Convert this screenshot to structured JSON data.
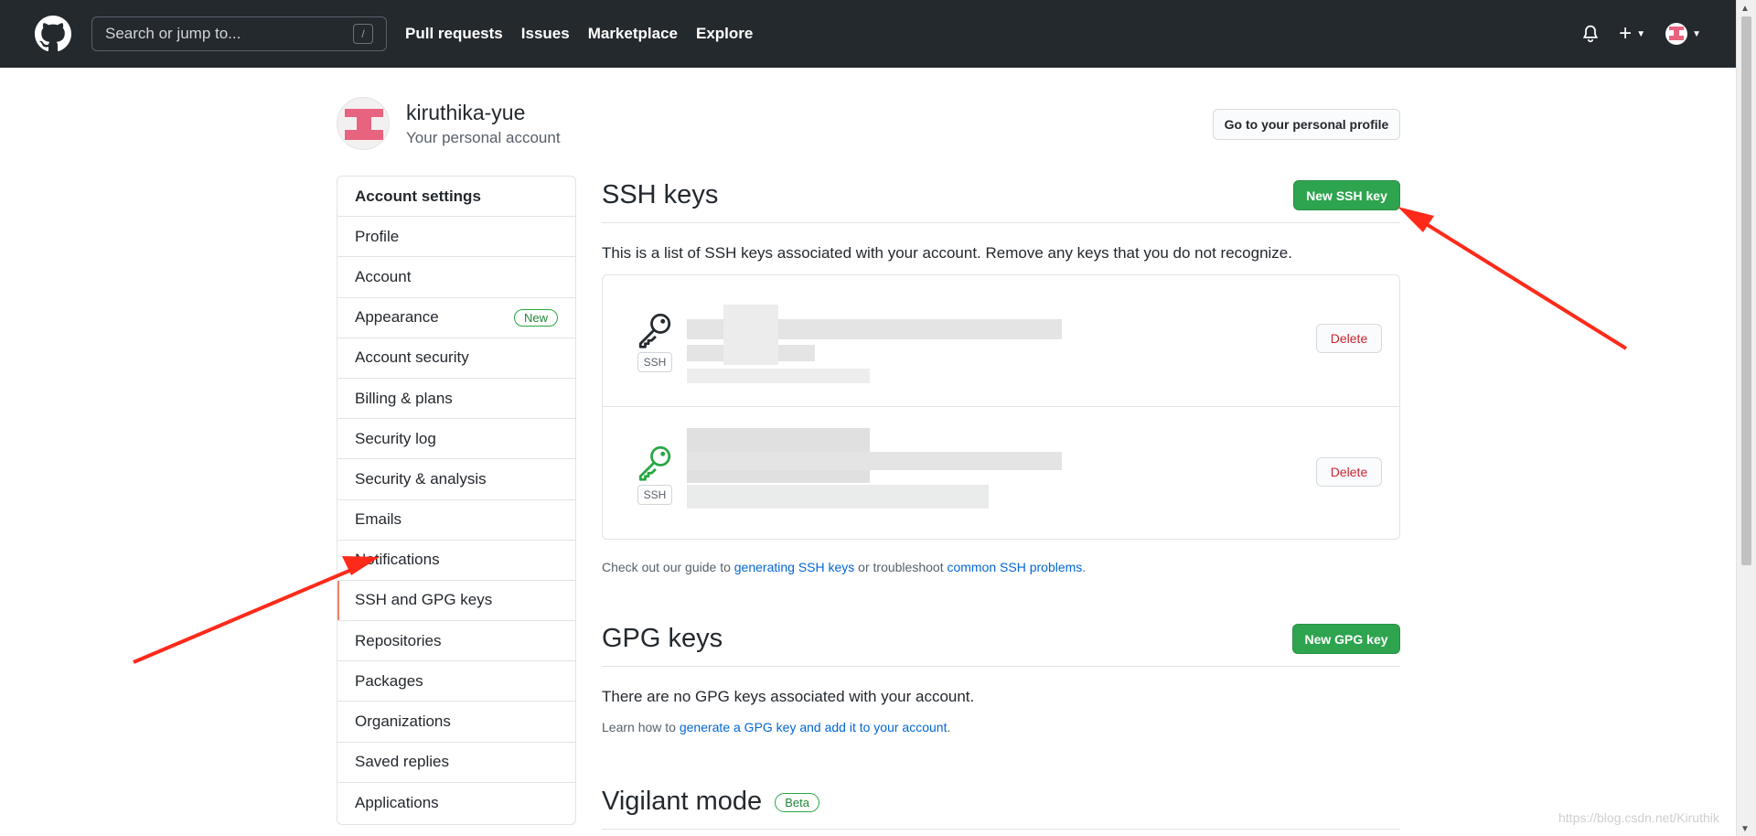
{
  "header": {
    "search_placeholder": "Search or jump to...",
    "search_shortcut": "/",
    "nav": [
      "Pull requests",
      "Issues",
      "Marketplace",
      "Explore"
    ],
    "plus_label": "+"
  },
  "profile": {
    "username": "kiruthika-yue",
    "subtitle": "Your personal account",
    "profile_button": "Go to your personal profile"
  },
  "sidebar": {
    "items": [
      {
        "label": "Account settings"
      },
      {
        "label": "Profile"
      },
      {
        "label": "Account"
      },
      {
        "label": "Appearance",
        "badge": "New"
      },
      {
        "label": "Account security"
      },
      {
        "label": "Billing & plans"
      },
      {
        "label": "Security log"
      },
      {
        "label": "Security & analysis"
      },
      {
        "label": "Emails"
      },
      {
        "label": "Notifications"
      },
      {
        "label": "SSH and GPG keys"
      },
      {
        "label": "Repositories"
      },
      {
        "label": "Packages"
      },
      {
        "label": "Organizations"
      },
      {
        "label": "Saved replies"
      },
      {
        "label": "Applications"
      }
    ]
  },
  "ssh": {
    "title": "SSH keys",
    "new_button": "New SSH key",
    "description": "This is a list of SSH keys associated with your account. Remove any keys that you do not recognize.",
    "keys": [
      {
        "tag": "SSH",
        "delete": "Delete",
        "icon_color": "#24292e"
      },
      {
        "tag": "SSH",
        "delete": "Delete",
        "icon_color": "#28a745"
      }
    ],
    "footer_prefix": "Check out our guide to ",
    "footer_link1": "generating SSH keys",
    "footer_middle": " or troubleshoot ",
    "footer_link2": "common SSH problems",
    "footer_suffix": "."
  },
  "gpg": {
    "title": "GPG keys",
    "new_button": "New GPG key",
    "empty": "There are no GPG keys associated with your account.",
    "learn_prefix": "Learn how to ",
    "learn_link": "generate a GPG key and add it to your account",
    "learn_suffix": "."
  },
  "vigilant": {
    "title": "Vigilant mode",
    "badge": "Beta"
  },
  "watermark": "https://blog.csdn.net/Kiruthik",
  "colors": {
    "header_bg": "#24292e",
    "primary_green": "#2ea44f",
    "link_blue": "#0366d6",
    "danger_red": "#cb2431",
    "annotation_red": "#ff2a1a"
  }
}
